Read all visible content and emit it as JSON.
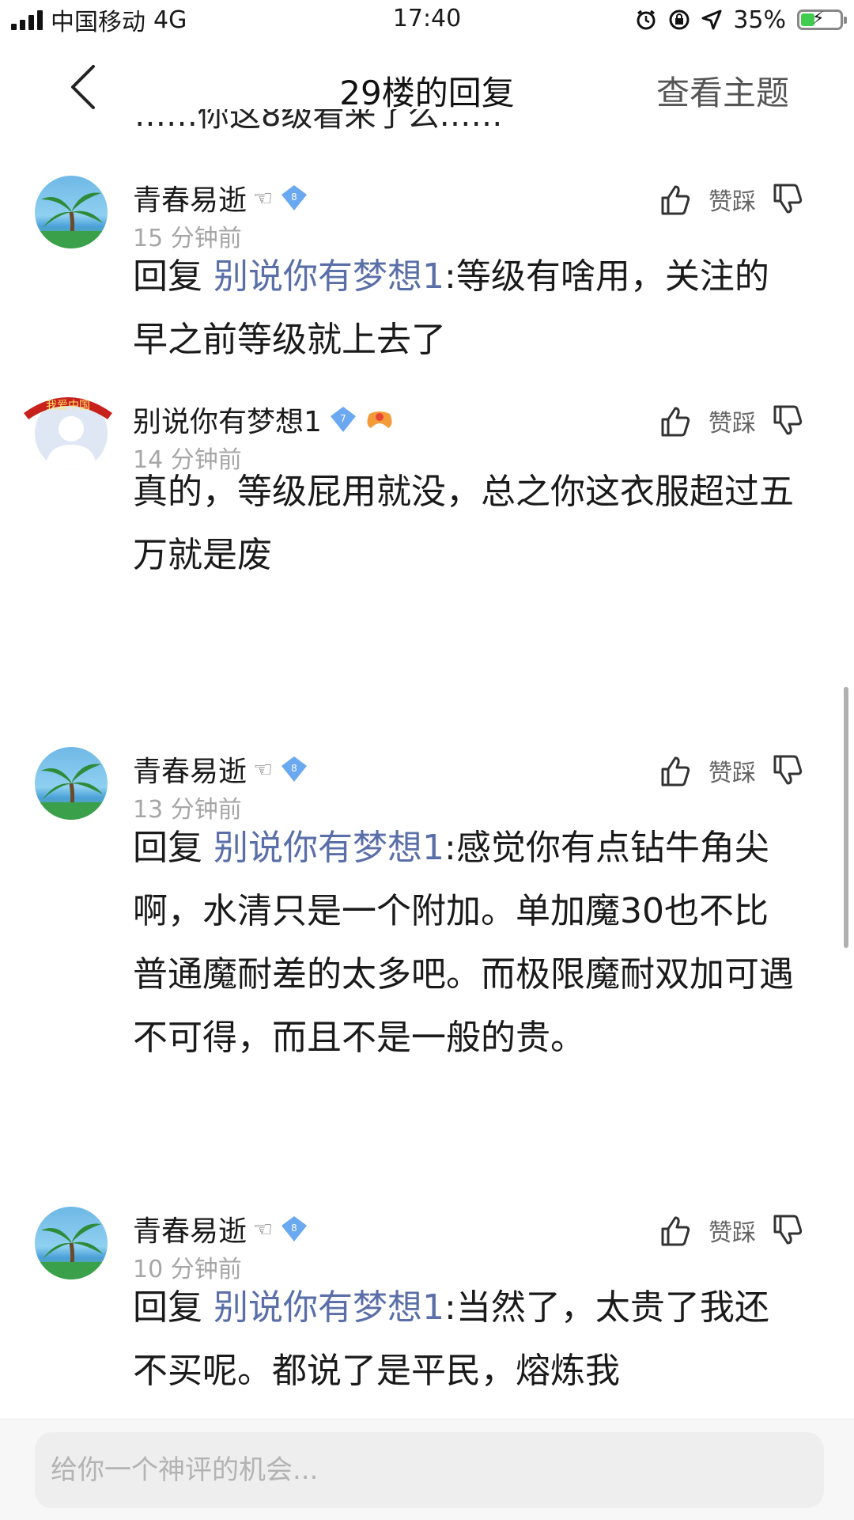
{
  "status": {
    "carrier": "中国移动",
    "network": "4G",
    "time": "17:40",
    "battery": "35%",
    "battery_level": 0.35,
    "accent_charging": "#3fcc4f"
  },
  "nav": {
    "title": "29楼的回复",
    "right_action": "查看主题"
  },
  "clipped_text": "……你这8级看来了么……",
  "labels": {
    "like_dislike": "赞踩"
  },
  "comments": [
    {
      "user": "青春易逝",
      "level": "8",
      "time": "15 分钟前",
      "reply_prefix": "回复 ",
      "reply_to": "别说你有梦想1",
      "text": ":等级有啥用，关注的早之前等级就上去了"
    },
    {
      "user": "别说你有梦想1",
      "level": "7",
      "time": "14 分钟前",
      "avatar_badge": "我爱中国",
      "text": "真的，等级屁用就没，总之你这衣服超过五万就是废"
    },
    {
      "user": "青春易逝",
      "level": "8",
      "time": "13 分钟前",
      "reply_prefix": "回复 ",
      "reply_to": "别说你有梦想1",
      "text": ":感觉你有点钻牛角尖啊，水清只是一个附加。单加魔30也不比普通魔耐差的太多吧。而极限魔耐双加可遇不可得，而且不是一般的贵。"
    },
    {
      "user": "青春易逝",
      "level": "8",
      "time": "10 分钟前",
      "reply_prefix": "回复 ",
      "reply_to": "别说你有梦想1",
      "text": ":当然了，太贵了我还不买呢。都说了是平民，熔炼我"
    }
  ],
  "input": {
    "placeholder": "给你一个神评的机会..."
  }
}
